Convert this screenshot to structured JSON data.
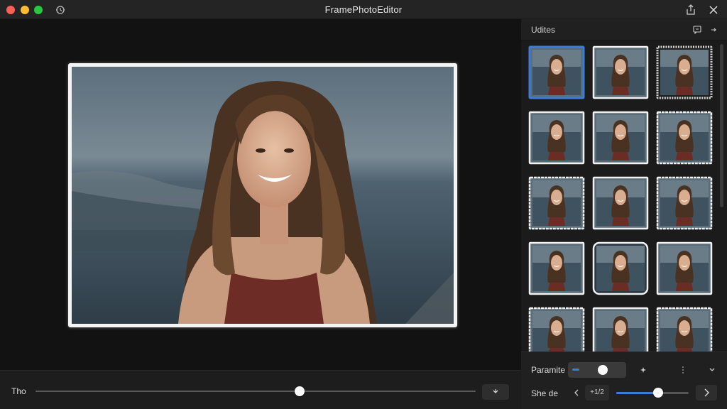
{
  "window": {
    "title": "FramePhotoEditor",
    "icons": [
      "close-dot",
      "minimize-dot",
      "maximize-dot",
      "history-icon",
      "share-icon",
      "close-icon"
    ]
  },
  "sidebar": {
    "title": "Udites",
    "icons": [
      "comment-icon",
      "collapse-icon"
    ],
    "frames": [
      {
        "style": "plain",
        "selected": true
      },
      {
        "style": "plain-white"
      },
      {
        "style": "dark-ornate"
      },
      {
        "style": "plain-white"
      },
      {
        "style": "plain-white"
      },
      {
        "style": "wavy"
      },
      {
        "style": "wavy"
      },
      {
        "style": "plain-white"
      },
      {
        "style": "wavy"
      },
      {
        "style": "plain-white"
      },
      {
        "style": "rounded-dark"
      },
      {
        "style": "plain-white"
      },
      {
        "style": "wavy"
      },
      {
        "style": "plain-white"
      },
      {
        "style": "wavy"
      }
    ]
  },
  "bottom": {
    "label": "Tho",
    "slider_value": 0.6,
    "button_icon": "chevron-down-icon"
  },
  "params": {
    "label1": "Paramite",
    "label2": "She de",
    "value_text": "+1/2",
    "slider_value": 0.58,
    "icons": [
      "sparkle-icon",
      "more-icon",
      "chevron-down-icon",
      "arrow-left-icon",
      "chevron-right-icon"
    ]
  },
  "colors": {
    "accent": "#3d7bd9",
    "selected_border": "#3d7bd9"
  }
}
